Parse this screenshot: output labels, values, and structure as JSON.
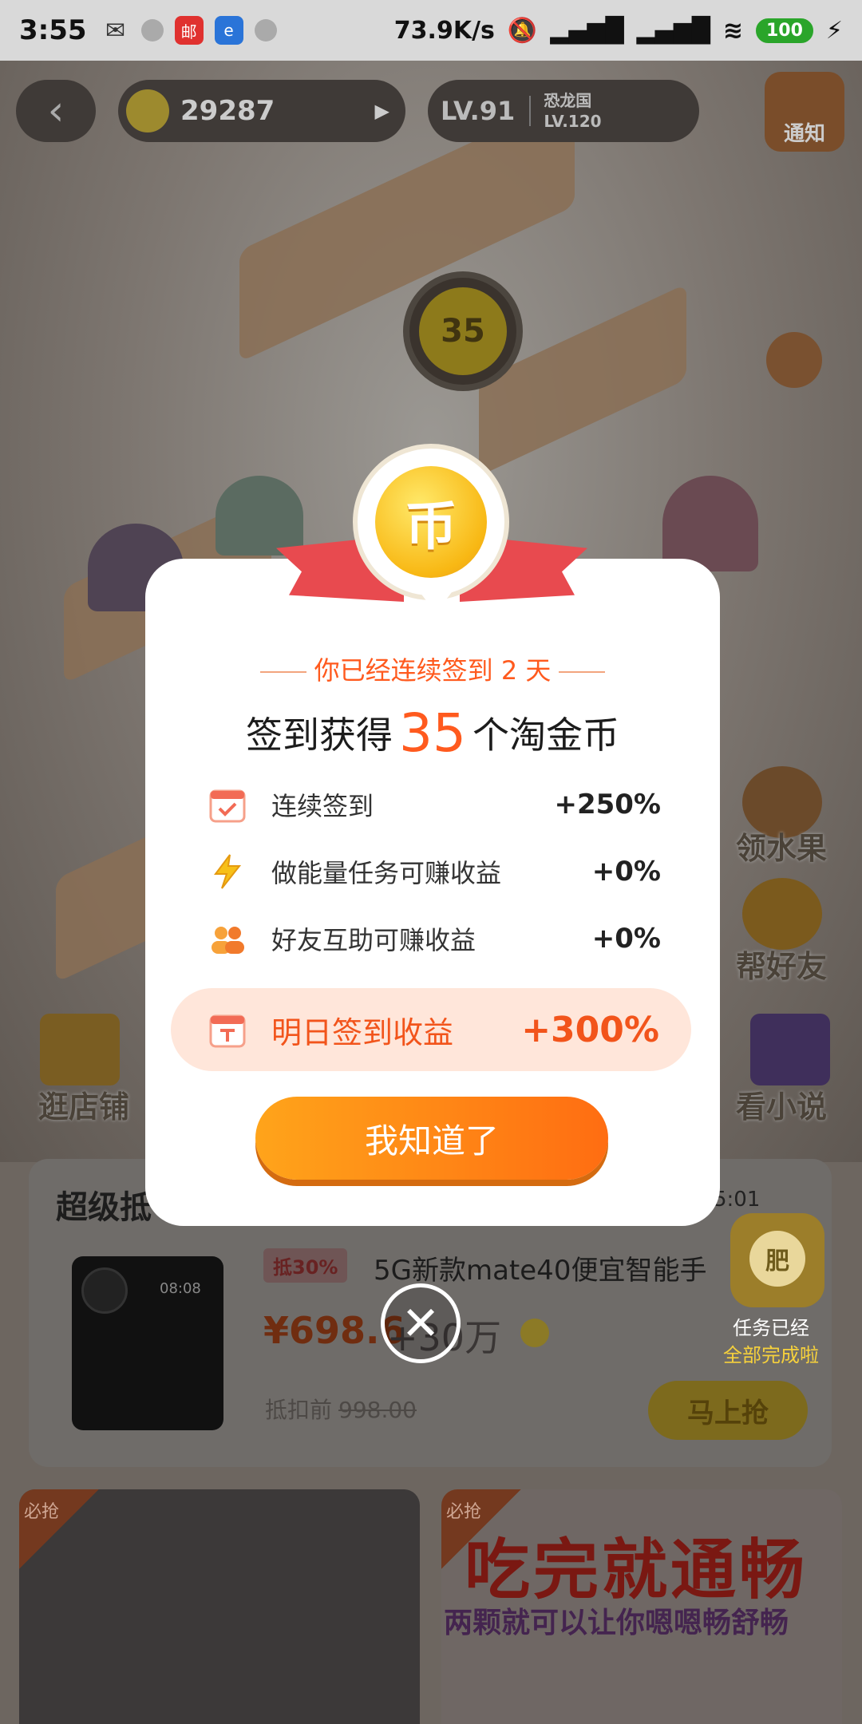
{
  "status_bar": {
    "time": "3:55",
    "network_speed": "73.9K/s",
    "battery": "100",
    "icons": [
      "wechat-icon",
      "circle-icon",
      "post-icon",
      "browser-icon",
      "circle-icon"
    ]
  },
  "game": {
    "coins": "29287",
    "level": "LV.91",
    "next_area_name": "恐龙国",
    "next_area_level": "LV.120",
    "notify_label": "通知",
    "pin_value": "35",
    "side_items": {
      "fruit": "领水果",
      "help_friend": "帮好友",
      "shop": "逛店铺",
      "novel": "看小说"
    }
  },
  "product": {
    "section_title": "超级抵",
    "countdown": "5:01",
    "discount_tag": "抵30%",
    "name": "5G新款mate40便宜智能手",
    "price": "¥698.6",
    "price_extra": "+30万",
    "old_price_label": "抵扣前",
    "old_price": "998.00",
    "buy_label": "马上抢",
    "phone_time": "08:08"
  },
  "fertilizer": {
    "bag_char": "肥",
    "line1": "任务已经",
    "line2": "全部完成啦"
  },
  "ads": {
    "tag": "必抢",
    "big_text": "吃完就通畅",
    "sub_text": "两颗就可以让你嗯嗯畅舒畅"
  },
  "modal": {
    "streak_text": "你已经连续签到 2 天",
    "headline_prefix": "签到获得",
    "headline_number": "35",
    "headline_suffix": "个淘金币",
    "rows": [
      {
        "label": "连续签到",
        "value": "+250%"
      },
      {
        "label": "做能量任务可赚收益",
        "value": "+0%"
      },
      {
        "label": "好友互助可赚收益",
        "value": "+0%"
      }
    ],
    "tomorrow_label": "明日签到收益",
    "tomorrow_value": "+300%",
    "ok_label": "我知道了",
    "coin_glyph": "币"
  },
  "colors": {
    "accent": "#ff5a1e",
    "button_start": "#ffa41a",
    "button_end": "#ff6d12",
    "ribbon": "#e84a4f",
    "coin": "#f8b814"
  }
}
